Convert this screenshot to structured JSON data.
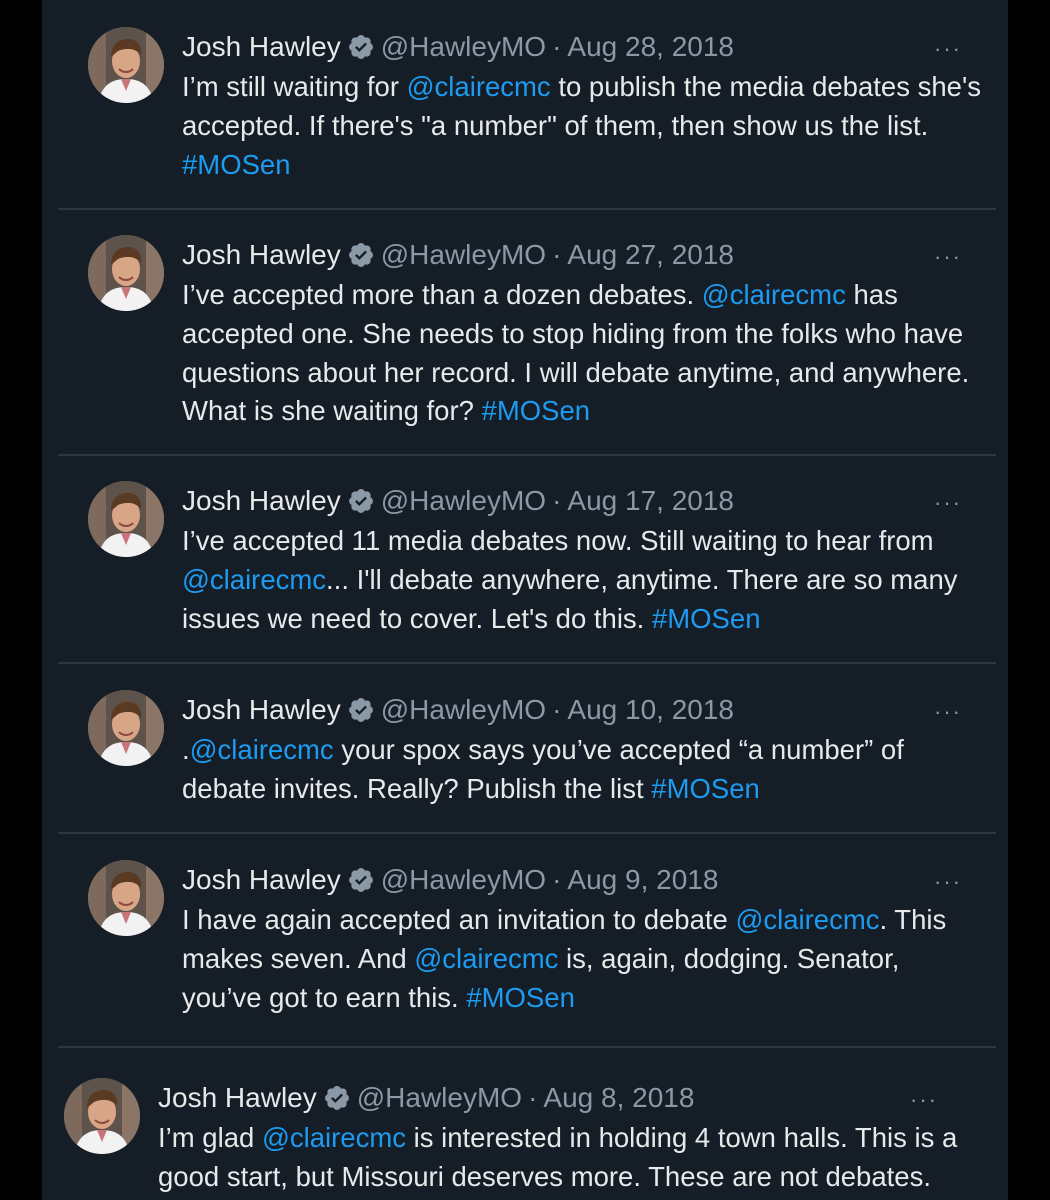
{
  "colors": {
    "background": "#151d27",
    "text": "#e7e9ea",
    "secondary": "#8b98a5",
    "link": "#1d9bf0",
    "divider": "#2c3540"
  },
  "icons": {
    "verified": "verified-badge-icon",
    "more": "more-options-icon"
  },
  "tweets": [
    {
      "name": "Josh Hawley",
      "handle": "@HawleyMO",
      "separator": "·",
      "date": "Aug 28, 2018",
      "more": "···",
      "parts": [
        {
          "text": "I’m still waiting for ",
          "link": false
        },
        {
          "text": "@clairecmc",
          "link": true
        },
        {
          "text": " to publish the media debates she's accepted. If there's \"a number\" of them, then show us the list. ",
          "link": false
        },
        {
          "text": "#MOSen",
          "link": true
        }
      ]
    },
    {
      "name": "Josh Hawley",
      "handle": "@HawleyMO",
      "separator": "·",
      "date": "Aug 27, 2018",
      "more": "···",
      "parts": [
        {
          "text": "I’ve accepted more than a dozen debates. ",
          "link": false
        },
        {
          "text": "@clairecmc",
          "link": true
        },
        {
          "text": " has accepted one. She needs to stop hiding from the folks who have questions about her record. I will debate anytime, and anywhere. What is she waiting for? ",
          "link": false
        },
        {
          "text": "#MOSen",
          "link": true
        }
      ]
    },
    {
      "name": "Josh Hawley",
      "handle": "@HawleyMO",
      "separator": "·",
      "date": "Aug 17, 2018",
      "more": "···",
      "parts": [
        {
          "text": "I’ve accepted 11 media debates now. Still waiting to hear from ",
          "link": false
        },
        {
          "text": "@clairecmc",
          "link": true
        },
        {
          "text": "... I'll debate anywhere, anytime. There are so many issues we need to cover. Let's do this. ",
          "link": false
        },
        {
          "text": "#MOSen",
          "link": true
        }
      ]
    },
    {
      "name": "Josh Hawley",
      "handle": "@HawleyMO",
      "separator": "·",
      "date": "Aug 10, 2018",
      "more": "···",
      "parts": [
        {
          "text": ".",
          "link": false
        },
        {
          "text": "@clairecmc",
          "link": true
        },
        {
          "text": " your spox says you’ve accepted “a number” of debate invites. Really? Publish the list ",
          "link": false
        },
        {
          "text": "#MOSen",
          "link": true
        }
      ]
    },
    {
      "name": "Josh Hawley",
      "handle": "@HawleyMO",
      "separator": "·",
      "date": "Aug 9, 2018",
      "more": "···",
      "parts": [
        {
          "text": "I have again accepted an invitation to debate ",
          "link": false
        },
        {
          "text": "@clairecmc",
          "link": true
        },
        {
          "text": ". This makes seven.  And ",
          "link": false
        },
        {
          "text": "@clairecmc",
          "link": true
        },
        {
          "text": " is, again, dodging. Senator, you’ve got to earn this. ",
          "link": false
        },
        {
          "text": "#MOSen",
          "link": true
        }
      ]
    },
    {
      "name": "Josh Hawley",
      "handle": "@HawleyMO",
      "separator": "·",
      "date": "Aug 8, 2018",
      "more": "···",
      "parts": [
        {
          "text": "I’m glad ",
          "link": false
        },
        {
          "text": "@clairecmc",
          "link": true
        },
        {
          "text": " is interested in holding 4 town halls. This is a good start, but Missouri deserves more. These are not debates.",
          "link": false
        }
      ]
    }
  ]
}
